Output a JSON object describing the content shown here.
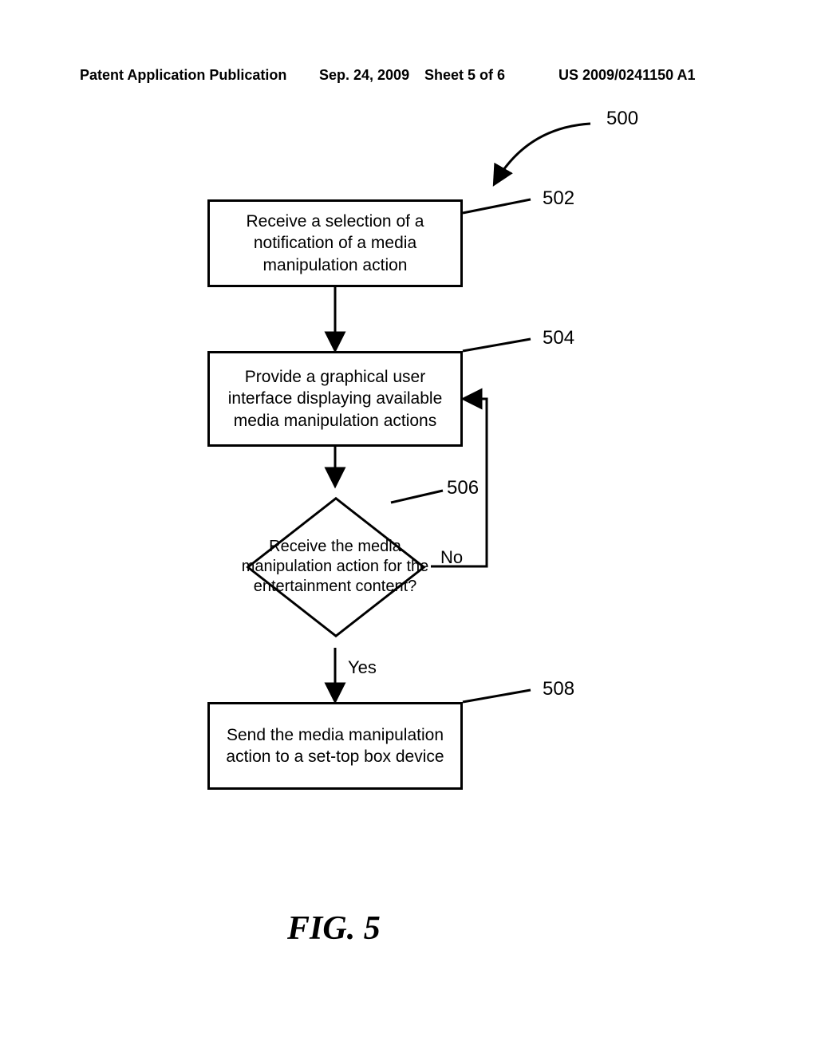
{
  "header": {
    "pub_label": "Patent Application Publication",
    "pub_date": "Sep. 24, 2009",
    "sheet_num": "Sheet 5 of 6",
    "pub_num": "US 2009/0241150 A1"
  },
  "figure": {
    "caption": "FIG. 5",
    "ref_main": "500",
    "nodes": {
      "n502": {
        "ref": "502",
        "text": "Receive a selection of a notification of a media manipulation action"
      },
      "n504": {
        "ref": "504",
        "text": "Provide a graphical user interface displaying available media manipulation actions"
      },
      "n506": {
        "ref": "506",
        "text": "Receive the media manipulation action for the entertainment content?"
      },
      "n508": {
        "ref": "508",
        "text": "Send the media manipulation action to a set-top box device"
      }
    },
    "edges": {
      "yes": "Yes",
      "no": "No"
    }
  }
}
